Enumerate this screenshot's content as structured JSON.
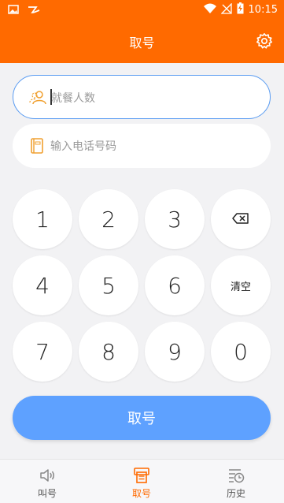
{
  "status_bar": {
    "time": "10:15",
    "icons": [
      "image-icon",
      "swirl-icon",
      "wifi-icon",
      "no-signal-icon",
      "battery-charging-icon"
    ]
  },
  "header": {
    "title": "取号",
    "settings_icon": "gear-icon"
  },
  "colors": {
    "brand": "#ff6a00",
    "accent": "#5ea1ff",
    "input_focus": "#5a9cf2"
  },
  "form": {
    "party_size": {
      "placeholder": "就餐人数",
      "icon": "people-icon"
    },
    "phone": {
      "placeholder": "输入电话号码",
      "icon": "phone-book-icon"
    }
  },
  "keypad": {
    "k1": "1",
    "k2": "2",
    "k3": "3",
    "k4": "4",
    "k5": "5",
    "k6": "6",
    "k7": "7",
    "k8": "8",
    "k9": "9",
    "k0": "0",
    "backspace_icon": "backspace-icon",
    "clear": "清空"
  },
  "submit_label": "取号",
  "tabbar": {
    "tabs": [
      {
        "label": "叫号",
        "icon": "speaker-icon"
      },
      {
        "label": "取号",
        "icon": "ticket-printer-icon"
      },
      {
        "label": "历史",
        "icon": "history-icon"
      }
    ],
    "active": "取号"
  }
}
